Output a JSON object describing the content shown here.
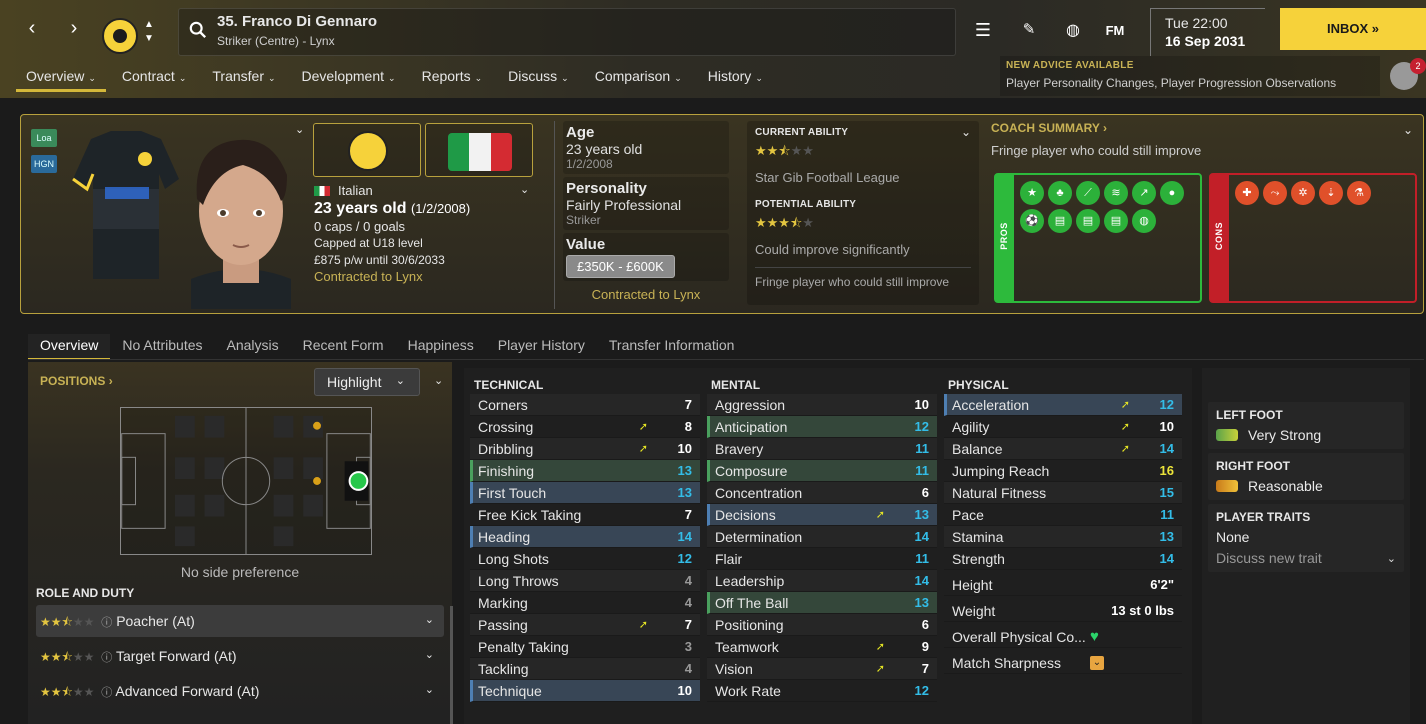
{
  "header": {
    "player_title": "35. Franco Di Gennaro",
    "player_sub": "Striker (Centre) - Lynx",
    "fm_label": "FM",
    "time": "Tue 22:00",
    "date": "16 Sep 2031",
    "inbox_label": "INBOX",
    "nav_tabs": [
      "Overview",
      "Contract",
      "Transfer",
      "Development",
      "Reports",
      "Discuss",
      "Comparison",
      "History"
    ],
    "advice_heading": "NEW ADVICE AVAILABLE",
    "advice_body": "Player Personality Changes, Player Progression Observations",
    "notif_count": "2"
  },
  "profile": {
    "tags": [
      "Loa",
      "HGN"
    ],
    "nationality": "Italian",
    "age_line": "23 years old",
    "dob_paren": "(1/2/2008)",
    "caps": "0 caps / 0 goals",
    "capped": "Capped at U18 level",
    "wage": "£875 p/w until 30/6/2033",
    "contracted": "Contracted to Lynx",
    "age_label": "Age",
    "age_value": "23 years old",
    "age_dob": "1/2/2008",
    "personality_label": "Personality",
    "personality_value": "Fairly Professional",
    "personality_sub": "Striker",
    "value_label": "Value",
    "value_range": "£350K - £600K",
    "value_contract": "Contracted to Lynx",
    "ca_label": "CURRENT ABILITY",
    "ca_stars": 2.5,
    "ca_league": "Star Gib Football League",
    "pa_label": "POTENTIAL ABILITY",
    "pa_stars": 3.5,
    "pa_text": "Could improve significantly",
    "ability_note": "Fringe player who could still improve",
    "coach_label": "COACH SUMMARY",
    "coach_text": "Fringe player who could still improve",
    "pros_label": "PROS",
    "cons_label": "CONS",
    "pros_icons": [
      "star-icon",
      "sprout-icon",
      "tape-icon",
      "ladder-icon",
      "chart-up-icon",
      "head-icon",
      "ball-icon",
      "report-icon",
      "report-icon",
      "report-icon",
      "report-icon",
      "globe-icon"
    ],
    "cons_icons": [
      "medical-cross-icon",
      "injury-icon",
      "break-icon",
      "stats-down-icon",
      "flask-icon"
    ]
  },
  "subtabs": [
    "Overview",
    "No Attributes",
    "Analysis",
    "Recent Form",
    "Happiness",
    "Player History",
    "Transfer Information"
  ],
  "positions": {
    "heading": "POSITIONS",
    "highlight": "Highlight",
    "side_pref": "No side preference",
    "role_heading": "ROLE AND DUTY",
    "roles": [
      {
        "name": "Poacher (At)",
        "stars": 2.5
      },
      {
        "name": "Target Forward (At)",
        "stars": 2.5
      },
      {
        "name": "Advanced Forward (At)",
        "stars": 2.5
      }
    ]
  },
  "technical": {
    "heading": "TECHNICAL",
    "rows": [
      {
        "name": "Corners",
        "value": "7",
        "color": "w",
        "hl": "",
        "trend": ""
      },
      {
        "name": "Crossing",
        "value": "8",
        "color": "w",
        "hl": "",
        "trend": "up"
      },
      {
        "name": "Dribbling",
        "value": "10",
        "color": "w",
        "hl": "",
        "trend": "up"
      },
      {
        "name": "Finishing",
        "value": "13",
        "color": "c",
        "hl": "g",
        "trend": ""
      },
      {
        "name": "First Touch",
        "value": "13",
        "color": "c",
        "hl": "b",
        "trend": ""
      },
      {
        "name": "Free Kick Taking",
        "value": "7",
        "color": "w",
        "hl": "",
        "trend": ""
      },
      {
        "name": "Heading",
        "value": "14",
        "color": "c",
        "hl": "b",
        "trend": ""
      },
      {
        "name": "Long Shots",
        "value": "12",
        "color": "c",
        "hl": "",
        "trend": ""
      },
      {
        "name": "Long Throws",
        "value": "4",
        "color": "gr",
        "hl": "",
        "trend": ""
      },
      {
        "name": "Marking",
        "value": "4",
        "color": "gr",
        "hl": "",
        "trend": ""
      },
      {
        "name": "Passing",
        "value": "7",
        "color": "w",
        "hl": "",
        "trend": "up"
      },
      {
        "name": "Penalty Taking",
        "value": "3",
        "color": "gr",
        "hl": "",
        "trend": ""
      },
      {
        "name": "Tackling",
        "value": "4",
        "color": "gr",
        "hl": "",
        "trend": ""
      },
      {
        "name": "Technique",
        "value": "10",
        "color": "w",
        "hl": "b",
        "trend": ""
      }
    ]
  },
  "mental": {
    "heading": "MENTAL",
    "rows": [
      {
        "name": "Aggression",
        "value": "10",
        "color": "w",
        "hl": "",
        "trend": ""
      },
      {
        "name": "Anticipation",
        "value": "12",
        "color": "c",
        "hl": "g",
        "trend": ""
      },
      {
        "name": "Bravery",
        "value": "11",
        "color": "c",
        "hl": "",
        "trend": ""
      },
      {
        "name": "Composure",
        "value": "11",
        "color": "c",
        "hl": "g",
        "trend": ""
      },
      {
        "name": "Concentration",
        "value": "6",
        "color": "w",
        "hl": "",
        "trend": ""
      },
      {
        "name": "Decisions",
        "value": "13",
        "color": "c",
        "hl": "b",
        "trend": "up"
      },
      {
        "name": "Determination",
        "value": "14",
        "color": "c",
        "hl": "",
        "trend": ""
      },
      {
        "name": "Flair",
        "value": "11",
        "color": "c",
        "hl": "",
        "trend": ""
      },
      {
        "name": "Leadership",
        "value": "14",
        "color": "c",
        "hl": "",
        "trend": ""
      },
      {
        "name": "Off The Ball",
        "value": "13",
        "color": "c",
        "hl": "g",
        "trend": ""
      },
      {
        "name": "Positioning",
        "value": "6",
        "color": "w",
        "hl": "",
        "trend": ""
      },
      {
        "name": "Teamwork",
        "value": "9",
        "color": "w",
        "hl": "",
        "trend": "up"
      },
      {
        "name": "Vision",
        "value": "7",
        "color": "w",
        "hl": "",
        "trend": "up"
      },
      {
        "name": "Work Rate",
        "value": "12",
        "color": "c",
        "hl": "",
        "trend": ""
      }
    ]
  },
  "physical": {
    "heading": "PHYSICAL",
    "rows": [
      {
        "name": "Acceleration",
        "value": "12",
        "color": "c",
        "hl": "b",
        "trend": "up"
      },
      {
        "name": "Agility",
        "value": "10",
        "color": "w",
        "hl": "",
        "trend": "up"
      },
      {
        "name": "Balance",
        "value": "14",
        "color": "c",
        "hl": "",
        "trend": "up"
      },
      {
        "name": "Jumping Reach",
        "value": "16",
        "color": "yy",
        "hl": "",
        "trend": ""
      },
      {
        "name": "Natural Fitness",
        "value": "15",
        "color": "c",
        "hl": "",
        "trend": ""
      },
      {
        "name": "Pace",
        "value": "11",
        "color": "c",
        "hl": "",
        "trend": ""
      },
      {
        "name": "Stamina",
        "value": "13",
        "color": "c",
        "hl": "",
        "trend": ""
      },
      {
        "name": "Strength",
        "value": "14",
        "color": "c",
        "hl": "",
        "trend": ""
      }
    ],
    "height_label": "Height",
    "height_value": "6'2\"",
    "weight_label": "Weight",
    "weight_value": "13 st 0 lbs",
    "opc_label": "Overall Physical Co...",
    "sharp_label": "Match Sharpness"
  },
  "foot": {
    "left_label": "LEFT FOOT",
    "left_value": "Very Strong",
    "right_label": "RIGHT FOOT",
    "right_value": "Reasonable",
    "traits_label": "PLAYER TRAITS",
    "traits_value": "None",
    "discuss": "Discuss new trait"
  },
  "colors": {
    "accent": "#f6d23a",
    "pros": "#2dba3c",
    "cons": "#c21f28",
    "highlight_blue": "#4e7fb3",
    "highlight_green": "#4aa05e",
    "attr_cyan": "#33bde8"
  }
}
